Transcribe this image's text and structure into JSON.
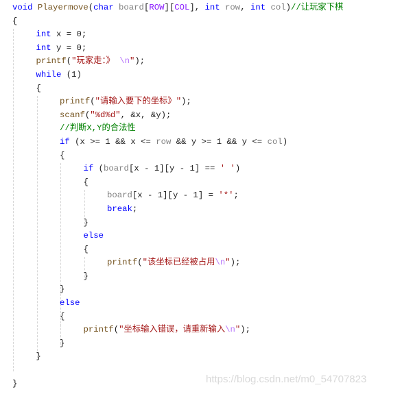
{
  "editor": {
    "indent_levels": [
      0,
      0,
      1,
      1,
      1,
      1,
      1,
      2,
      2,
      2,
      2,
      2,
      3,
      3,
      4,
      4,
      3,
      3,
      3,
      4,
      3,
      2,
      2,
      2,
      3,
      2,
      1,
      0,
      0
    ],
    "lines": [
      [
        [
          "k",
          "void"
        ],
        [
          "t",
          " "
        ],
        [
          "f",
          "Playermove"
        ],
        [
          "t",
          "("
        ],
        [
          "k",
          "char"
        ],
        [
          "t",
          " "
        ],
        [
          "p",
          "board"
        ],
        [
          "t",
          "["
        ],
        [
          "m",
          "ROW"
        ],
        [
          "t",
          "]["
        ],
        [
          "m",
          "COL"
        ],
        [
          "t",
          "], "
        ],
        [
          "k",
          "int"
        ],
        [
          "t",
          " "
        ],
        [
          "p",
          "row"
        ],
        [
          "t",
          ", "
        ],
        [
          "k",
          "int"
        ],
        [
          "t",
          " "
        ],
        [
          "p",
          "col"
        ],
        [
          "t",
          ")"
        ],
        [
          "c",
          "//让玩家下棋"
        ]
      ],
      [
        [
          "t",
          "{"
        ]
      ],
      [
        [
          "k",
          "int"
        ],
        [
          "t",
          " x = 0;"
        ]
      ],
      [
        [
          "k",
          "int"
        ],
        [
          "t",
          " y = 0;"
        ]
      ],
      [
        [
          "f",
          "printf"
        ],
        [
          "t",
          "("
        ],
        [
          "s",
          "\"玩家走：》 "
        ],
        [
          "e",
          "\\n"
        ],
        [
          "s",
          "\""
        ],
        [
          "t",
          ");"
        ]
      ],
      [
        [
          "k",
          "while"
        ],
        [
          "t",
          " (1)"
        ]
      ],
      [
        [
          "t",
          "{"
        ]
      ],
      [
        [
          "f",
          "printf"
        ],
        [
          "t",
          "("
        ],
        [
          "s",
          "\"请输入要下的坐标》\""
        ],
        [
          "t",
          ");"
        ]
      ],
      [
        [
          "f",
          "scanf"
        ],
        [
          "t",
          "("
        ],
        [
          "s",
          "\"%d%d\""
        ],
        [
          "t",
          ", &x, &y);"
        ]
      ],
      [
        [
          "c",
          "//判断X,Y的合法性"
        ]
      ],
      [
        [
          "k",
          "if"
        ],
        [
          "t",
          " (x >= 1 && x <= "
        ],
        [
          "p",
          "row"
        ],
        [
          "t",
          " && y >= 1 && y <= "
        ],
        [
          "p",
          "col"
        ],
        [
          "t",
          ")"
        ]
      ],
      [
        [
          "t",
          "{"
        ]
      ],
      [
        [
          "k",
          "if"
        ],
        [
          "t",
          " ("
        ],
        [
          "p",
          "board"
        ],
        [
          "t",
          "[x - 1][y - 1] == "
        ],
        [
          "s",
          "' '"
        ],
        [
          "t",
          ")"
        ]
      ],
      [
        [
          "t",
          "{"
        ]
      ],
      [
        [
          "p",
          "board"
        ],
        [
          "t",
          "[x - 1][y - 1] = "
        ],
        [
          "s",
          "'*'"
        ],
        [
          "t",
          ";"
        ]
      ],
      [
        [
          "k",
          "break"
        ],
        [
          "t",
          ";"
        ]
      ],
      [
        [
          "t",
          "}"
        ]
      ],
      [
        [
          "k",
          "else"
        ]
      ],
      [
        [
          "t",
          "{"
        ]
      ],
      [
        [
          "f",
          "printf"
        ],
        [
          "t",
          "("
        ],
        [
          "s",
          "\"该坐标已经被占用"
        ],
        [
          "e",
          "\\n"
        ],
        [
          "s",
          "\""
        ],
        [
          "t",
          ");"
        ]
      ],
      [
        [
          "t",
          "}"
        ]
      ],
      [
        [
          "t",
          "}"
        ]
      ],
      [
        [
          "k",
          "else"
        ]
      ],
      [
        [
          "t",
          "{"
        ]
      ],
      [
        [
          "f",
          "printf"
        ],
        [
          "t",
          "("
        ],
        [
          "s",
          "\"坐标输入错误，请重新输入"
        ],
        [
          "e",
          "\\n"
        ],
        [
          "s",
          "\""
        ],
        [
          "t",
          ");"
        ]
      ],
      [
        [
          "t",
          "}"
        ]
      ],
      [
        [
          "t",
          "}"
        ]
      ],
      [],
      [
        [
          "t",
          "}"
        ]
      ]
    ]
  },
  "watermark": "https://blog.csdn.net/m0_54707823"
}
